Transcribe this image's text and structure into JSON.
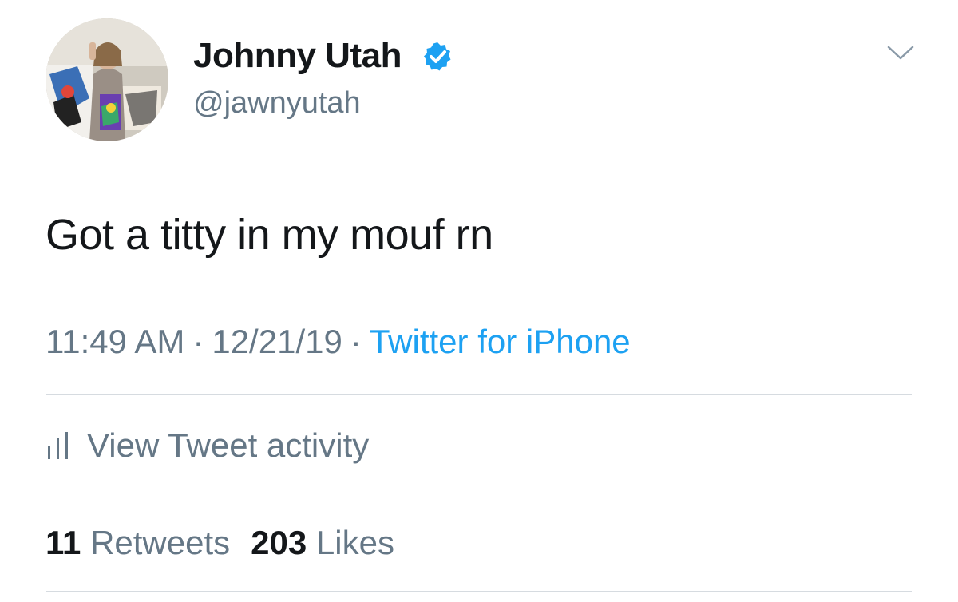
{
  "user": {
    "display_name": "Johnny Utah",
    "handle": "@jawnyutah",
    "verified": true
  },
  "tweet": {
    "text": "Got a titty in my mouf rn",
    "time": "11:49 AM",
    "date": "12/21/19",
    "separator": "·",
    "source": "Twitter for iPhone"
  },
  "activity": {
    "label": "View Tweet activity"
  },
  "stats": {
    "retweets_count": "11",
    "retweets_label": "Retweets",
    "likes_count": "203",
    "likes_label": "Likes"
  },
  "icons": {
    "verified": "verified-badge-icon",
    "chevron": "chevron-down-icon",
    "activity": "bar-chart-icon"
  },
  "colors": {
    "accent": "#1da1f2",
    "text": "#14171a",
    "secondary": "#657786",
    "divider": "#d6dbe0"
  }
}
